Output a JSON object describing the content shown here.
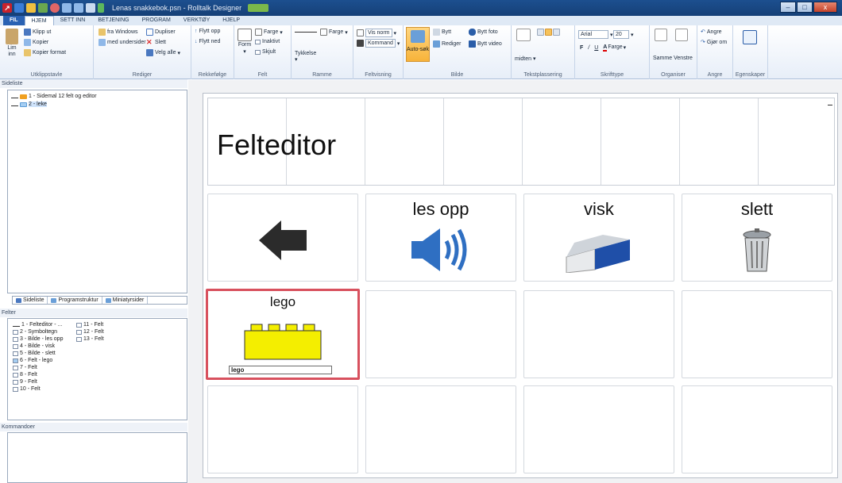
{
  "window": {
    "file_name": "Lenas snakkebok.psn",
    "app_name": "Rolltalk Designer",
    "controls": [
      "–",
      "□",
      "x"
    ]
  },
  "tabs": [
    "FIL",
    "HJEM",
    "SETT INN",
    "BETJENING",
    "PROGRAM",
    "VERKTØY",
    "HJELP"
  ],
  "ribbon": {
    "utklippstavle": {
      "paste": "Lim inn",
      "cut": "Klipp ut",
      "copy": "Kopier",
      "format": "Kopier format",
      "label": "Utklippstavle"
    },
    "rediger": {
      "from_windows": "fra Windows",
      "with_subpages": "med undersider",
      "duplicate": "Dupliser",
      "delete": "Slett",
      "select_all": "Velg alle",
      "label": "Rediger"
    },
    "rekkefolge": {
      "move_up": "Flytt opp",
      "move_down": "Flytt ned",
      "label": "Rekkefølge"
    },
    "felt": {
      "form": "Form",
      "color": "Farge",
      "inactive": "Inaktivt",
      "hidden": "Skjult",
      "label": "Felt"
    },
    "ramme": {
      "thickness": "Tykkelse",
      "color": "Farge",
      "label": "Ramme"
    },
    "feltvisning": {
      "show_norm": "Vis norm",
      "commands": "Kommand",
      "label": "Feltvisning"
    },
    "bilde": {
      "auto_search": "Auto-søk",
      "change": "Bytt",
      "edit": "Rediger",
      "change_photo": "Bytt foto",
      "change_video": "Bytt video",
      "label": "Bilde"
    },
    "tekstplassering": {
      "middle": "midten",
      "label": "Tekstplassering"
    },
    "skrifttype": {
      "font": "Arial",
      "size": "20",
      "bold": "F",
      "italic": "/",
      "underline": "U",
      "color": "Farge",
      "label": "Skrifttype"
    },
    "organiser": {
      "same": "Samme",
      "left": "Venstre",
      "label": "Organiser"
    },
    "angre": {
      "undo": "Angre",
      "redo": "Gjør om",
      "label": "Angre"
    },
    "egenskaper": {
      "label": "Egenskaper"
    }
  },
  "sideliste": {
    "title": "Sideliste",
    "items": [
      "1 - Sidemal 12 felt og editor",
      "2 - leke"
    ]
  },
  "panel_tabs": [
    "Sideliste",
    "Programstruktur",
    "Miniatyrsider"
  ],
  "felter": {
    "title": "Felter",
    "col1": [
      "1 - Felteditor - ...",
      "2 - Symboltegn",
      "3 - Bilde - les opp",
      "4 - Bilde - visk",
      "5 - Bilde - slett",
      "6 - Felt - lego",
      "7 - Felt",
      "8 - Felt",
      "9 - Felt",
      "10 - Felt"
    ],
    "col2": [
      "11 - Felt",
      "12 - Felt",
      "13 - Felt"
    ]
  },
  "kommandoer": {
    "title": "Kommandoer"
  },
  "board": {
    "editor_title": "Felteditor",
    "cells": [
      {
        "label": "",
        "icon": "arrow-left-icon"
      },
      {
        "label": "les opp",
        "icon": "speaker-icon"
      },
      {
        "label": "visk",
        "icon": "eraser-icon"
      },
      {
        "label": "slett",
        "icon": "trash-can-icon"
      },
      {
        "label": "lego",
        "icon": "lego-brick-icon",
        "input": "lego"
      }
    ],
    "selected_color": "#d8515e"
  }
}
